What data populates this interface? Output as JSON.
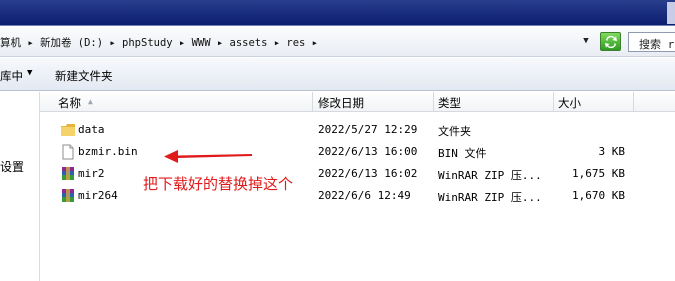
{
  "address": {
    "path": "算机 ▸ 新加卷 (D:) ▸ phpStudy ▸ WWW ▸ assets ▸ res ▸",
    "search_placeholder": "搜索 r"
  },
  "toolbar": {
    "organize_label": "库中",
    "new_folder_label": "新建文件夹"
  },
  "navpane": {
    "item_label": "设置"
  },
  "columns": {
    "name": "名称",
    "date": "修改日期",
    "type": "类型",
    "size": "大小"
  },
  "files": [
    {
      "name": "data",
      "date": "2022/5/27 12:29",
      "type": "文件夹",
      "size": "",
      "icon": "folder-icon"
    },
    {
      "name": "bzmir.bin",
      "date": "2022/6/13 16:00",
      "type": "BIN 文件",
      "size": "3 KB",
      "icon": "file-icon"
    },
    {
      "name": "mir2",
      "date": "2022/6/13 16:02",
      "type": "WinRAR ZIP 压...",
      "size": "1,675 KB",
      "icon": "winrar-icon"
    },
    {
      "name": "mir264",
      "date": "2022/6/6 12:49",
      "type": "WinRAR ZIP 压...",
      "size": "1,670 KB",
      "icon": "winrar-icon"
    }
  ],
  "annotation": {
    "text": "把下载好的替换掉这个",
    "color": "#e01a1a"
  }
}
